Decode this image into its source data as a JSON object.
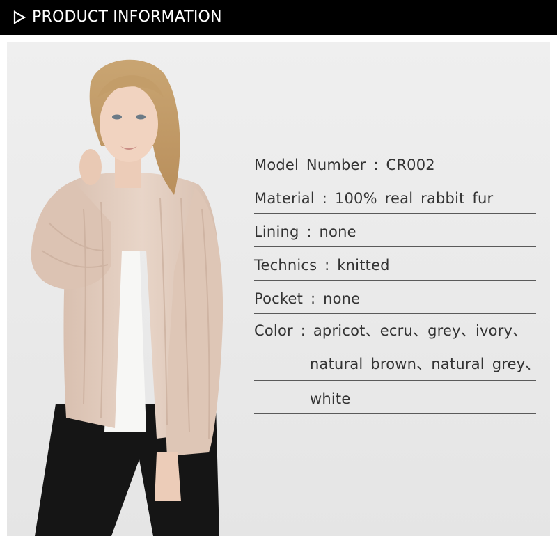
{
  "header": {
    "title": "PRODUCT INFORMATION",
    "icon": "play-triangle-icon"
  },
  "specs": [
    {
      "text": "Model Number : CR002"
    },
    {
      "text": "Material : 100% real rabbit fur"
    },
    {
      "text": "Lining : none"
    },
    {
      "text": "Technics : knitted"
    },
    {
      "text": "Pocket : none"
    },
    {
      "text": "Color : apricot、ecru、grey、ivory、"
    },
    {
      "text": "natural brown、natural grey、"
    },
    {
      "text": "white"
    }
  ],
  "colors": {
    "header_bg": "#000000",
    "fur": "#e3cdbf",
    "text": "#333333"
  }
}
